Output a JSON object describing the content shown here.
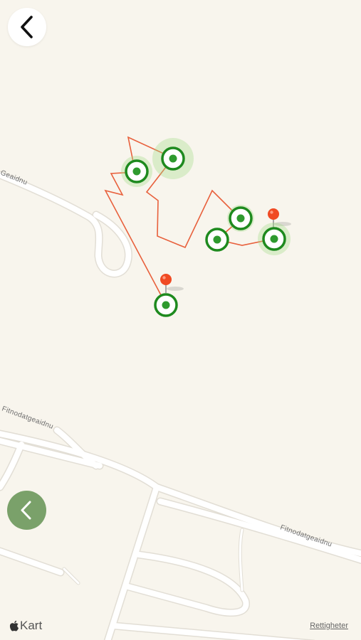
{
  "map": {
    "streets": [
      {
        "name": "Geaidnu"
      },
      {
        "name": "Fitnodatgeaidnu"
      },
      {
        "name": "Fitnodatgeaidnu"
      }
    ],
    "route_color": "#e8603c",
    "marker_color": "#1e8a1e",
    "pin_color": "#f04a23"
  },
  "controls": {
    "back_icon": "chevron-left-icon",
    "previous_icon": "chevron-left-icon",
    "previous_color": "#7aa16a"
  },
  "footer": {
    "brand_icon": "apple-logo-icon",
    "brand_label": "Kart",
    "legal_label": "Rettigheter"
  }
}
